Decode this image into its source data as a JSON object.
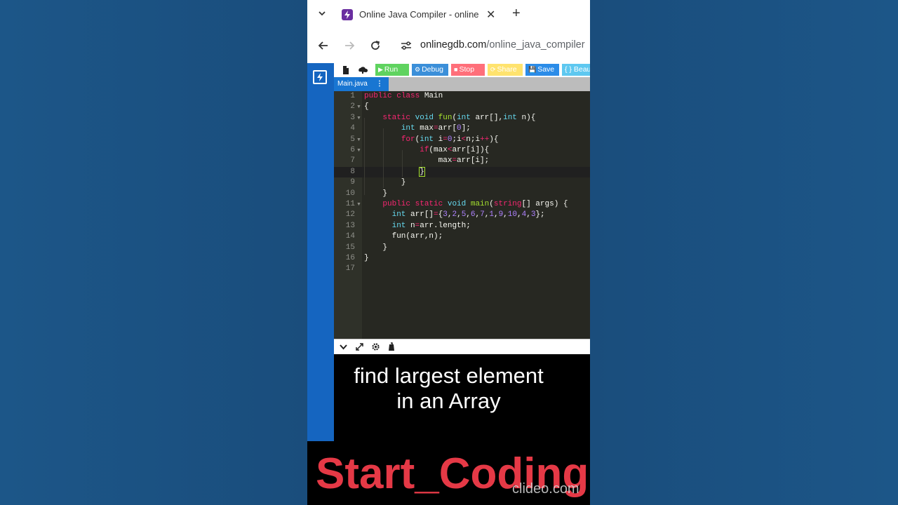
{
  "browser": {
    "tab_title": "Online Java Compiler - online",
    "url_domain": "onlinegdb.com",
    "url_path": "/online_java_compiler",
    "icons": [
      "chevron-down-icon",
      "favicon-bolt-icon",
      "close-icon",
      "plus-icon",
      "back-arrow-icon",
      "forward-arrow-icon",
      "reload-icon",
      "site-settings-icon"
    ]
  },
  "ide": {
    "toolbar": {
      "run": "Run",
      "debug": "Debug",
      "stop": "Stop",
      "share": "Share",
      "save": "Save",
      "beautify": "{ } Beau"
    },
    "file_tab": "Main.java",
    "colors": {
      "run": "#5fd35f",
      "debug": "#3b8fd9",
      "stop": "#ff6f7a",
      "share": "#ffe36e",
      "save": "#2b8ce8",
      "beautify": "#5ec8f0"
    }
  },
  "code_lines": [
    "1",
    "2",
    "3",
    "4",
    "5",
    "6",
    "7",
    "8",
    "9",
    "10",
    "11",
    "12",
    "13",
    "14",
    "15",
    "16",
    "17"
  ],
  "caption": {
    "line1": "find largest element",
    "line2": "in an Array"
  },
  "brand": "Start_Coding",
  "watermark": "clideo.com"
}
